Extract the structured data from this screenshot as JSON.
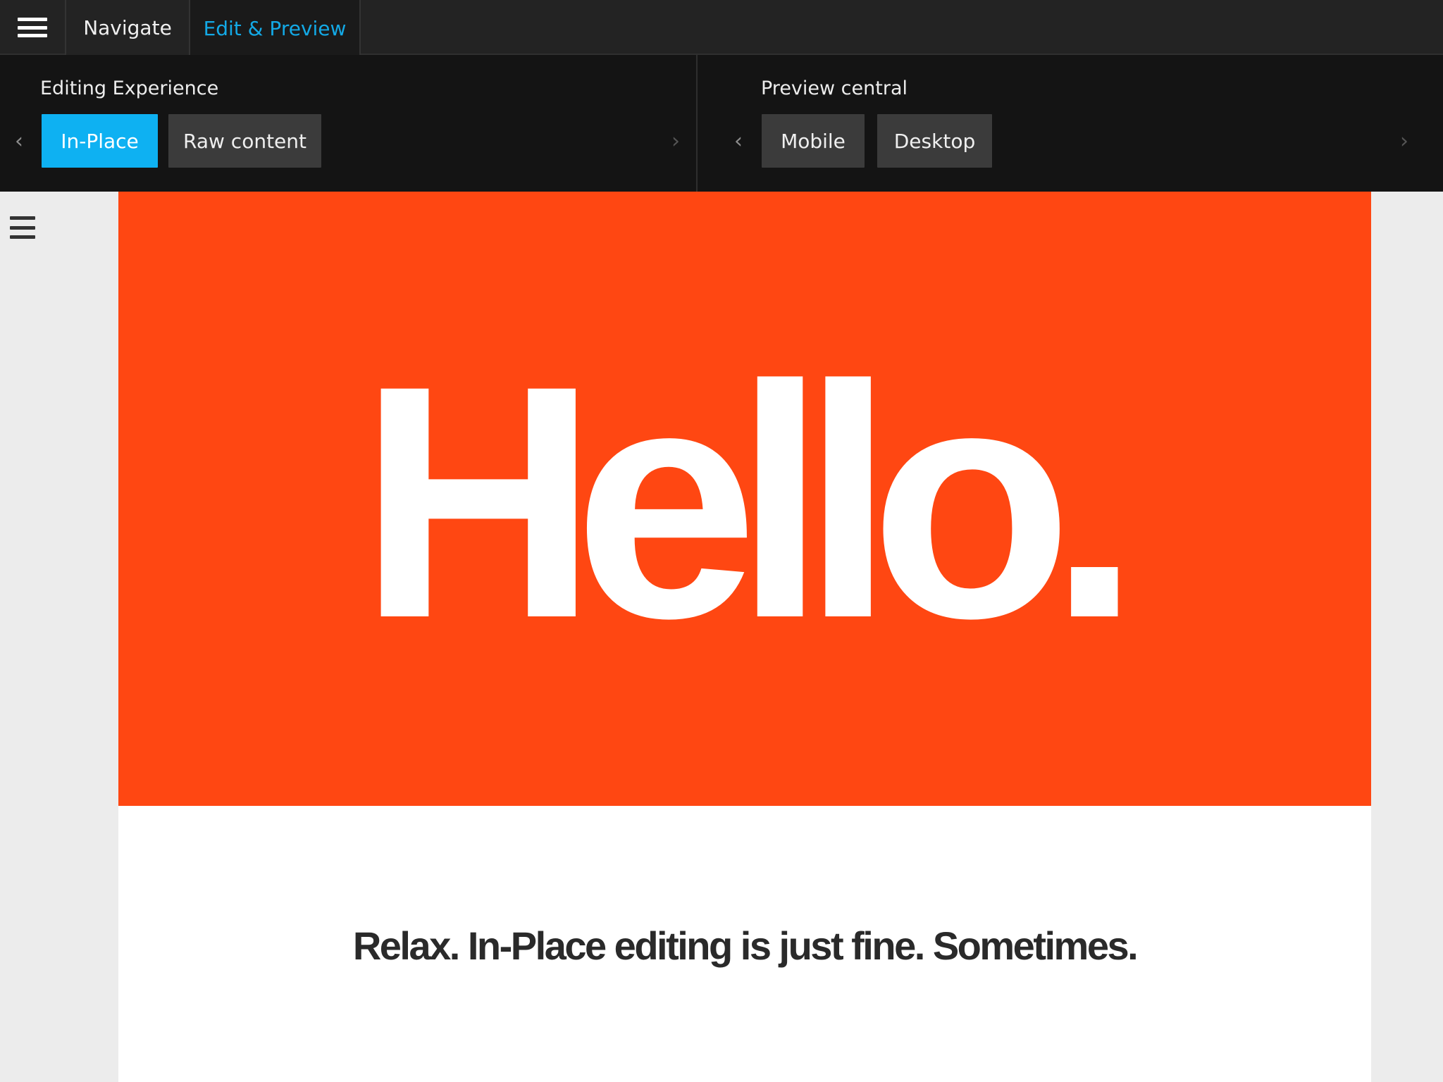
{
  "topbar": {
    "menu_icon": "hamburger-icon",
    "tabs": [
      {
        "label": "Navigate",
        "active": false
      },
      {
        "label": "Edit & Preview",
        "active": true
      }
    ],
    "active_color": "#13a9e6"
  },
  "editing": {
    "title": "Editing Experience",
    "buttons": [
      {
        "label": "In-Place",
        "selected": true
      },
      {
        "label": "Raw content",
        "selected": false
      }
    ],
    "selected_color": "#0eb1f2"
  },
  "preview": {
    "title": "Preview central",
    "buttons": [
      {
        "label": "Mobile"
      },
      {
        "label": "Desktop"
      }
    ]
  },
  "icons": {
    "prev": "chevron-left-icon",
    "next": "chevron-right-icon",
    "side_menu": "hamburger-icon"
  },
  "content": {
    "hero_text": "Hello.",
    "hero_color": "#ff4712",
    "tagline": "Relax. In-Place editing is just fine. Sometimes."
  }
}
